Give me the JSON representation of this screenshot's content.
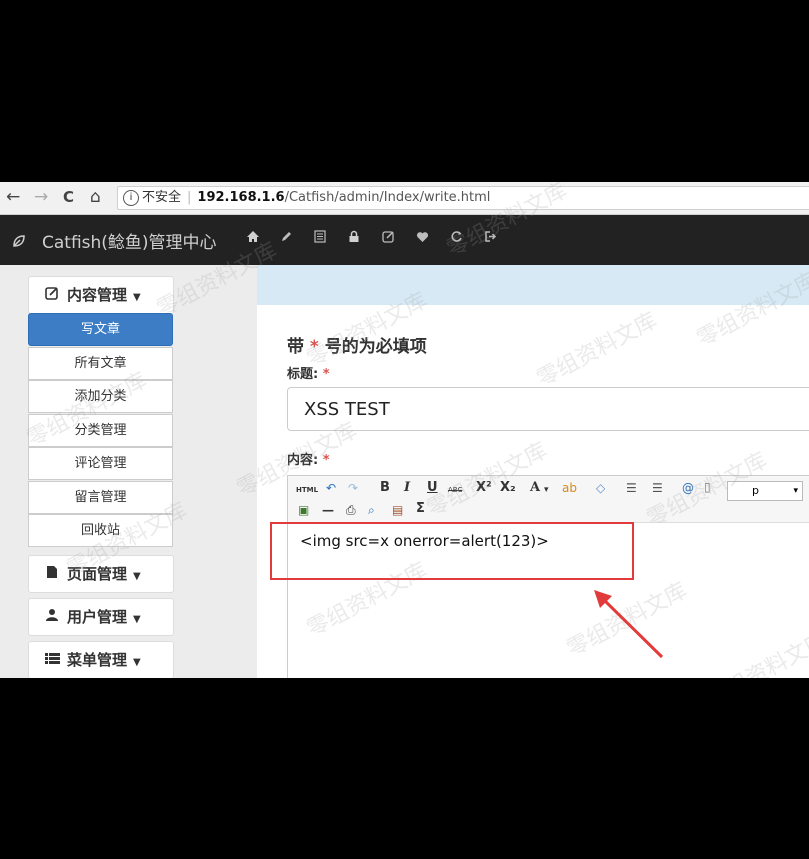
{
  "browser": {
    "back": "←",
    "forward": "→",
    "reload": "C",
    "home": "⌂",
    "info_icon": "i",
    "security_label": "不安全",
    "url_host": "192.168.1.6",
    "url_path": "/Catfish/admin/Index/write.html"
  },
  "app": {
    "brand": "Catfish(鲶鱼)管理中心",
    "nav_icons": [
      "home-icon",
      "pencil-icon",
      "list-icon",
      "lock-icon",
      "edit-icon",
      "heart-icon",
      "refresh-icon",
      "logout-icon"
    ]
  },
  "sidebar": {
    "content_group": "内容管理",
    "items": [
      "写文章",
      "所有文章",
      "添加分类",
      "分类管理",
      "评论管理",
      "留言管理",
      "回收站"
    ],
    "page_group": "页面管理",
    "user_group": "用户管理",
    "menu_group": "菜单管理"
  },
  "form": {
    "required_note_prefix": "带",
    "required_star": "*",
    "required_note_suffix": "号的为必填项",
    "title_label": "标题:",
    "title_value": "XSS TEST",
    "content_label": "内容:",
    "paragraph_select": "p",
    "editor_text": "<img src=x onerror=alert(123)>"
  },
  "toolbar": {
    "html": "HTML",
    "bold": "B",
    "italic": "I",
    "underline": "U",
    "strike": "ABC",
    "sup": "X²",
    "sub": "X₂",
    "fontcolor": "A",
    "sigma": "Σ"
  },
  "watermark": "零组资料文库",
  "colors": {
    "accent": "#3c7dc6",
    "highlight_box": "#e23b3b",
    "topnav": "#222222"
  }
}
